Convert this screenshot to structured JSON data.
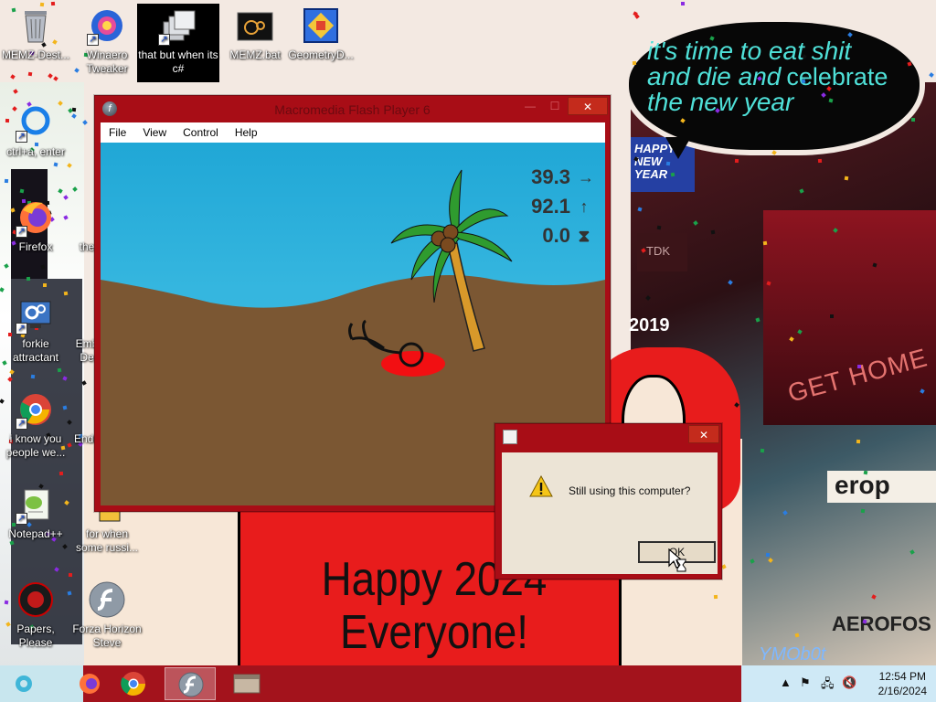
{
  "wallpaper": {
    "speech_line1": "it's time to eat shit",
    "speech_line2a": "and die and",
    "speech_line2b": "celebrate",
    "speech_line3": "the new year",
    "happy_sign": "HAPPY NEW YEAR",
    "tdk": "TDK",
    "year_sign": "2019",
    "get_home": "GET HOME",
    "sticker": "erop",
    "erofo": "AEROFOS",
    "watermark": "YMOb0t",
    "cartoon_line1": "Happy 2024",
    "cartoon_line2": "Everyone!"
  },
  "desktop_icons": [
    {
      "label": "MEMZ-Dest...",
      "icon": "recycle-bin-icon"
    },
    {
      "label": "Winaero Tweaker",
      "icon": "winaero-icon"
    },
    {
      "label": "that but when its c#",
      "icon": "stacked-windows-icon"
    },
    {
      "label": "MEMZ.bat",
      "icon": "batch-file-icon"
    },
    {
      "label": "GeometryD...",
      "icon": "geometry-dash-icon"
    },
    {
      "label": "ctrl+a, enter",
      "icon": "cortana-ring-icon"
    },
    {
      "label": "Firefox",
      "icon": "firefox-icon"
    },
    {
      "label": "the",
      "icon": "generic-icon"
    },
    {
      "label": "forkie attractant",
      "icon": "settings-monitor-icon"
    },
    {
      "label": "Emb De",
      "icon": "generic-icon"
    },
    {
      "label": "i know you people we...",
      "icon": "chrome-icon"
    },
    {
      "label": "Endo",
      "icon": "generic-icon"
    },
    {
      "label": "Notepad++",
      "icon": "notepad-plus-icon"
    },
    {
      "label": "for when some russi...",
      "icon": "generic-icon"
    },
    {
      "label": "Papers, Please",
      "icon": "papers-please-icon"
    },
    {
      "label": "Forza Horizon Steve",
      "icon": "flash-icon"
    }
  ],
  "flash_window": {
    "title": "Macromedia Flash Player 6",
    "menu": [
      "File",
      "View",
      "Control",
      "Help"
    ],
    "stats": [
      {
        "value": "39.3",
        "glyph": "→",
        "icon": "arrow-right-icon"
      },
      {
        "value": "92.1",
        "glyph": "↑",
        "icon": "arrow-up-icon"
      },
      {
        "value": "0.0",
        "glyph": "⧗",
        "icon": "hourglass-icon"
      }
    ]
  },
  "dialog": {
    "title": "",
    "message": "Still using this computer?",
    "ok_label": "OK"
  },
  "taskbar": {
    "items": [
      "ie-icon",
      "firefox-icon",
      "chrome-icon",
      "flash-player-icon",
      "window-icon"
    ],
    "time": "12:54 PM",
    "date": "2/16/2024"
  },
  "colors": {
    "window_frame": "#a80d16",
    "close_button": "#c42b1c",
    "sky": "#2fb3de",
    "sand": "#7b5733",
    "taskbar_mid": "#a3131c"
  }
}
